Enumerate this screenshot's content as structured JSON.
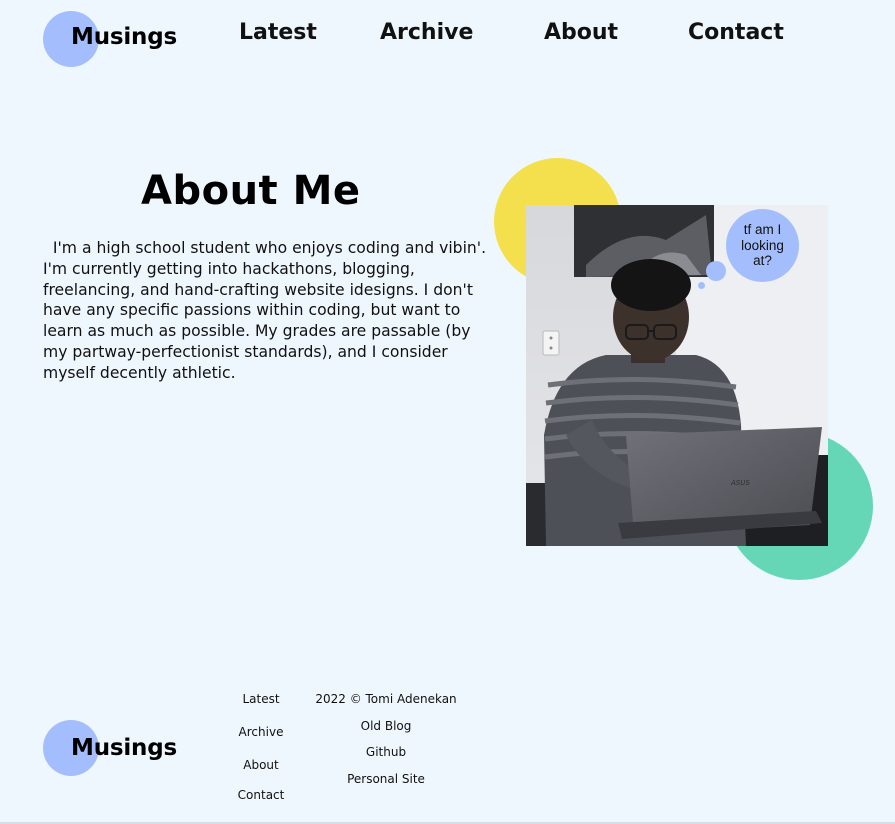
{
  "header": {
    "logo_text": "Musings",
    "nav": {
      "latest": "Latest",
      "archive": "Archive",
      "about": "About",
      "contact": "Contact"
    }
  },
  "about": {
    "title": "About Me",
    "body": "  I'm a high school student who enjoys coding and vibin'.  I'm currently getting into hackathons, blogging, freelancing, and hand-crafting website idesigns. I don't have any specific passions within coding, but want to learn as much as possible. My grades are passable (by my partway-perfectionist standards), and I consider myself decently athletic.",
    "thought_bubble": "tf am I looking at?"
  },
  "footer": {
    "logo_text": "Musings",
    "nav": {
      "latest": "Latest",
      "archive": "Archive",
      "about": "About",
      "contact": "Contact"
    },
    "copyright": "2022 © Tomi Adenekan",
    "links": {
      "old_blog": "Old Blog",
      "github": "Github",
      "personal_site": "Personal Site"
    }
  },
  "colors": {
    "background": "#eff7fe",
    "accent_blue": "#a4befd",
    "accent_yellow": "#f4e04d",
    "accent_green": "#66d7b6"
  }
}
